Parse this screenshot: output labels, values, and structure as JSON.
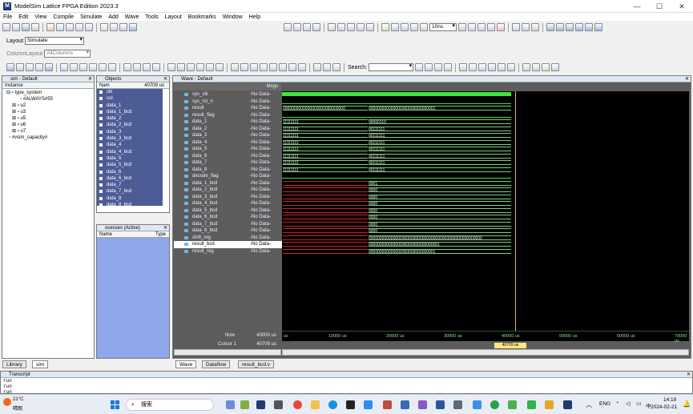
{
  "window": {
    "title": "ModelSim Lattice FPGA Edition 2023.3",
    "logo": "M",
    "min": "—",
    "max": "☐",
    "close": "✕"
  },
  "menu": [
    "File",
    "Edit",
    "View",
    "Compile",
    "Simulate",
    "Add",
    "Wave",
    "Tools",
    "Layout",
    "Bookmarks",
    "Window",
    "Help"
  ],
  "toolbar": {
    "layout_label": "Layout",
    "layout_value": "Simulate",
    "column_layout_label": "ColumnLayout",
    "column_layout_value": "AllColumns",
    "run_length": "10ns",
    "search_label": "Search:"
  },
  "sim_panel": {
    "title": "sim - Default",
    "col_instance": "Instance",
    "items": [
      "type_system",
      "#ALWAYS#55",
      "u2",
      "u3",
      "u5",
      "u6",
      "u7",
      "#vsim_capacity#"
    ]
  },
  "objects_panel": {
    "title": "Objects",
    "col_name": "Nam",
    "col_value": "40709 us",
    "items": [
      "clk",
      "col",
      "data_1",
      "data_1_bcd",
      "data_2",
      "data_2_bcd",
      "data_3",
      "data_3_bcd",
      "data_4",
      "data_4_bcd",
      "data_5",
      "data_5_bcd",
      "data_6",
      "data_6_bcd",
      "data_7",
      "data_7_bcd",
      "data_8",
      "data_8_bcd"
    ]
  },
  "processes_panel": {
    "title": "ocesses (Active)",
    "col_name": "Name",
    "col_type": "Type"
  },
  "wave_panel": {
    "title": "Wave - Default",
    "msgs_header": "Msgs",
    "signals": [
      {
        "name": "sys_clk",
        "msg": "-No Data-"
      },
      {
        "name": "sys_rst_n",
        "msg": "-No Data-"
      },
      {
        "name": "result",
        "msg": "-No Data-"
      },
      {
        "name": "result_flag",
        "msg": "-No Data-"
      },
      {
        "name": "data_1",
        "msg": "-No Data-"
      },
      {
        "name": "data_2",
        "msg": "-No Data-"
      },
      {
        "name": "data_3",
        "msg": "-No Data-"
      },
      {
        "name": "data_4",
        "msg": "-No Data-"
      },
      {
        "name": "data_5",
        "msg": "-No Data-"
      },
      {
        "name": "data_6",
        "msg": "-No Data-"
      },
      {
        "name": "data_7",
        "msg": "-No Data-"
      },
      {
        "name": "data_8",
        "msg": "-No Data-"
      },
      {
        "name": "decode_flag",
        "msg": "-No Data-"
      },
      {
        "name": "data_1_bcd",
        "msg": "-No Data-"
      },
      {
        "name": "data_2_bcd",
        "msg": "-No Data-"
      },
      {
        "name": "data_3_bcd",
        "msg": "-No Data-"
      },
      {
        "name": "data_4_bcd",
        "msg": "-No Data-"
      },
      {
        "name": "data_5_bcd",
        "msg": "-No Data-"
      },
      {
        "name": "data_6_bcd",
        "msg": "-No Data-"
      },
      {
        "name": "data_7_bcd",
        "msg": "-No Data-"
      },
      {
        "name": "data_8_bcd",
        "msg": "-No Data-"
      },
      {
        "name": "shift_reg",
        "msg": "-No Data-"
      },
      {
        "name": "result_bcd",
        "msg": "-No Data-"
      },
      {
        "name": "result_reg",
        "msg": "-No Data-"
      }
    ],
    "wave_values": {
      "result_a": "0000000000000000000000000000",
      "result_b": "000000000000000000000000000001",
      "data_1a": "11111111",
      "data_1b": "00000110",
      "data_2b": "00111111",
      "data_3b": "00111111",
      "data_4b": "00111111",
      "data_5b": "00111111",
      "data_6b": "00111111",
      "data_7b": "00111111",
      "data_8b": "00111111",
      "data_1_bcd_b": "0001",
      "bcd_b": "0000",
      "shift_reg_b": "000000000000000000000000000000000000000000000000000",
      "result_bcd_b": "00000000000000000000000000000001",
      "result_reg_b": "000000000000000000000000000001"
    },
    "now_label": "Now",
    "now_value": "40000 us",
    "cursor_label": "Cursor 1",
    "cursor_value": "40709 us",
    "cursor_flag": "40709 us",
    "timeline": [
      "us",
      "10000 us",
      "20000 us",
      "30000 us",
      "40000 us",
      "50000 us",
      "60000 us",
      "70000 us"
    ]
  },
  "bottom_tabs": {
    "library": "Library",
    "sim": "sim",
    "wave": "Wave",
    "dataflow": "Dataflow",
    "result_bcd": "result_bcd.v"
  },
  "transcript": {
    "title": "Transcript",
    "lines": [
      "run",
      "run",
      "run"
    ]
  },
  "taskbar": {
    "weather_temp": "21°C",
    "weather_desc": "晴朗",
    "search_placeholder": "搜索",
    "lang": "ENG",
    "lang2": "中",
    "time": "14:19",
    "date": "2024-02-21"
  }
}
